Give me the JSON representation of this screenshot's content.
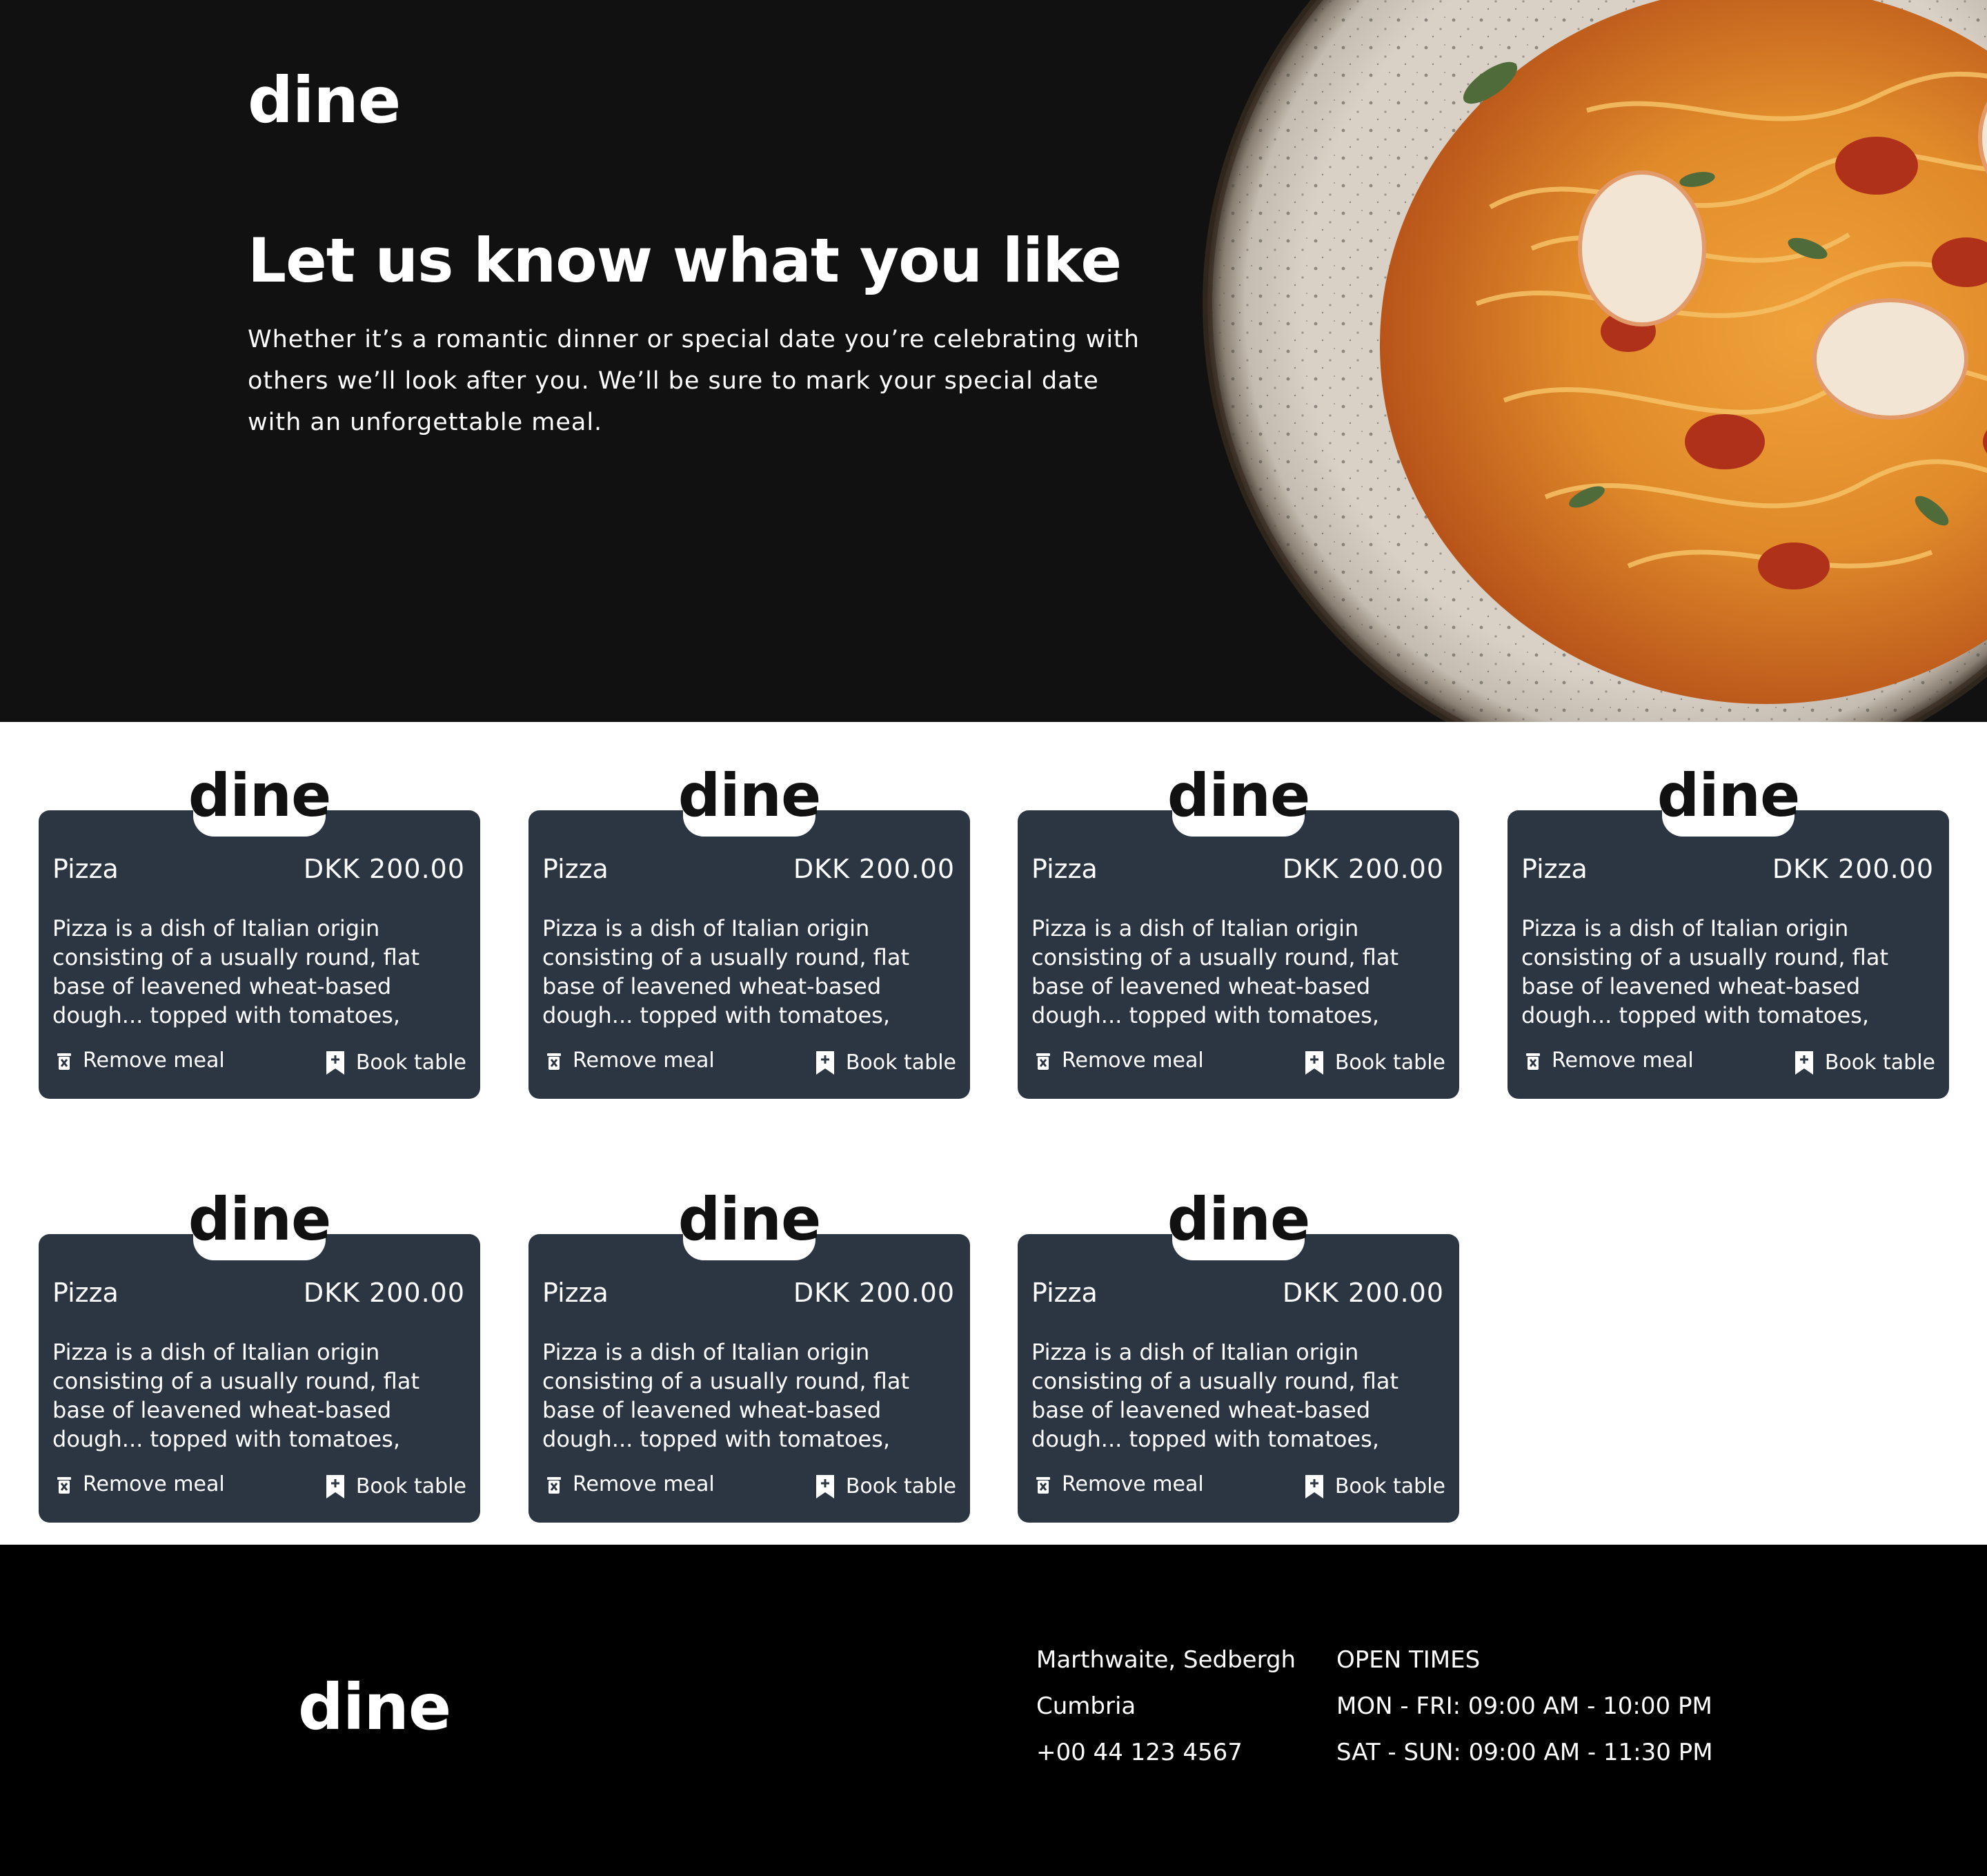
{
  "brand": "dine",
  "hero": {
    "heading": "Let us know what you like",
    "text": "Whether it’s a romantic dinner or special date you’re celebrating with others we’ll look after you. We’ll be sure to mark your special date with an unforgettable meal."
  },
  "cards": [
    {
      "badge": "dine",
      "name": "Pizza",
      "price": "DKK 200.00",
      "description": "Pizza is a dish of Italian origin consisting of a usually round, flat base of leavened wheat-based dough... topped with tomatoes, cheese, and",
      "remove_label": "Remove meal",
      "book_label": "Book table"
    },
    {
      "badge": "dine",
      "name": "Pizza",
      "price": "DKK 200.00",
      "description": "Pizza is a dish of Italian origin consisting of a usually round, flat base of leavened wheat-based dough... topped with tomatoes, cheese, and",
      "remove_label": "Remove meal",
      "book_label": "Book table"
    },
    {
      "badge": "dine",
      "name": "Pizza",
      "price": "DKK 200.00",
      "description": "Pizza is a dish of Italian origin consisting of a usually round, flat base of leavened wheat-based dough... topped with tomatoes, cheese, and",
      "remove_label": "Remove meal",
      "book_label": "Book table"
    },
    {
      "badge": "dine",
      "name": "Pizza",
      "price": "DKK 200.00",
      "description": "Pizza is a dish of Italian origin consisting of a usually round, flat base of leavened wheat-based dough... topped with tomatoes, cheese, and",
      "remove_label": "Remove meal",
      "book_label": "Book table"
    },
    {
      "badge": "dine",
      "name": "Pizza",
      "price": "DKK 200.00",
      "description": "Pizza is a dish of Italian origin consisting of a usually round, flat base of leavened wheat-based dough... topped with tomatoes, cheese, and",
      "remove_label": "Remove meal",
      "book_label": "Book table"
    },
    {
      "badge": "dine",
      "name": "Pizza",
      "price": "DKK 200.00",
      "description": "Pizza is a dish of Italian origin consisting of a usually round, flat base of leavened wheat-based dough... topped with tomatoes, cheese, and",
      "remove_label": "Remove meal",
      "book_label": "Book table"
    },
    {
      "badge": "dine",
      "name": "Pizza",
      "price": "DKK 200.00",
      "description": "Pizza is a dish of Italian origin consisting of a usually round, flat base of leavened wheat-based dough... topped with tomatoes, cheese, and",
      "remove_label": "Remove meal",
      "book_label": "Book table"
    }
  ],
  "footer": {
    "logo": "dine",
    "address": [
      "Marthwaite, Sedbergh",
      "Cumbria",
      "+00 44 123 4567"
    ],
    "times": [
      "OPEN TIMES",
      "MON - FRI: 09:00 AM - 10:00 PM",
      "SAT - SUN: 09:00 AM - 11:30 PM"
    ]
  },
  "icons": {
    "remove": "trash-icon",
    "book": "bookmark-plus-icon"
  },
  "colors": {
    "hero_bg": "#111111",
    "card_bg": "#2c3643",
    "footer_bg": "#000000",
    "text": "#ffffff"
  }
}
